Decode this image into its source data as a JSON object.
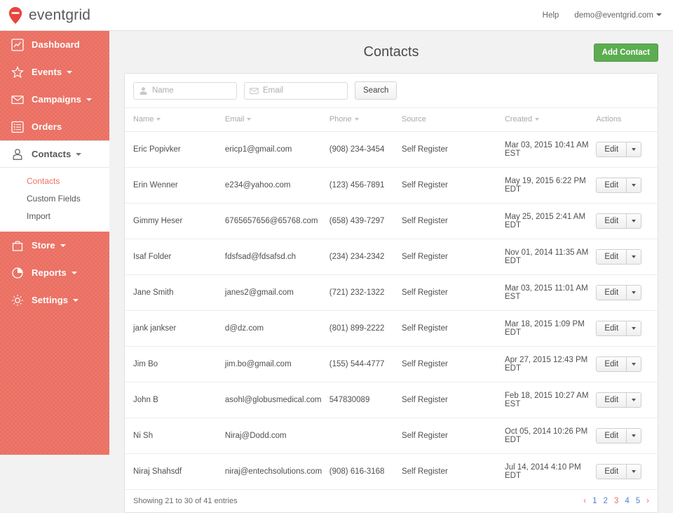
{
  "brand": {
    "name": "eventgrid",
    "logo_icon": "location-pin-icon",
    "accent": "#eb6f62"
  },
  "topbar": {
    "help_label": "Help",
    "account_label": "demo@eventgrid.com"
  },
  "sidebar": {
    "items": [
      {
        "label": "Dashboard",
        "icon": "chart-icon",
        "caret": false,
        "active": false
      },
      {
        "label": "Events",
        "icon": "star-icon",
        "caret": true,
        "active": false
      },
      {
        "label": "Campaigns",
        "icon": "envelope-icon",
        "caret": true,
        "active": false
      },
      {
        "label": "Orders",
        "icon": "list-icon",
        "caret": false,
        "active": false
      },
      {
        "label": "Contacts",
        "icon": "person-icon",
        "caret": true,
        "active": true
      },
      {
        "label": "Store",
        "icon": "bag-icon",
        "caret": true,
        "active": false
      },
      {
        "label": "Reports",
        "icon": "pie-icon",
        "caret": true,
        "active": false
      },
      {
        "label": "Settings",
        "icon": "gear-icon",
        "caret": true,
        "active": false
      }
    ],
    "submenu": [
      {
        "label": "Contacts",
        "current": true
      },
      {
        "label": "Custom Fields",
        "current": false
      },
      {
        "label": "Import",
        "current": false
      }
    ]
  },
  "page": {
    "title": "Contacts",
    "add_button_label": "Add Contact",
    "add_button_color": "#5cad51"
  },
  "search": {
    "name_placeholder": "Name",
    "name_value": "",
    "name_icon": "person-icon",
    "email_placeholder": "Email",
    "email_value": "",
    "email_icon": "envelope-icon",
    "search_button_label": "Search"
  },
  "table": {
    "columns": [
      {
        "label": "Name",
        "sortable": true
      },
      {
        "label": "Email",
        "sortable": true
      },
      {
        "label": "Phone",
        "sortable": true
      },
      {
        "label": "Source",
        "sortable": false
      },
      {
        "label": "Created",
        "sortable": true
      },
      {
        "label": "Actions",
        "sortable": false
      }
    ],
    "edit_label": "Edit",
    "rows": [
      {
        "name": "Eric Popivker",
        "email": "ericp1@gmail.com",
        "phone": "(908) 234-3454",
        "source": "Self Register",
        "created": "Mar 03, 2015 10:41 AM EST"
      },
      {
        "name": "Erin Wenner",
        "email": "e234@yahoo.com",
        "phone": "(123) 456-7891",
        "source": "Self Register",
        "created": "May 19, 2015 6:22 PM EDT"
      },
      {
        "name": "Gimmy Heser",
        "email": "6765657656@65768.com",
        "phone": "(658) 439-7297",
        "source": "Self Register",
        "created": "May 25, 2015 2:41 AM EDT"
      },
      {
        "name": "Isaf Folder",
        "email": "fdsfsad@fdsafsd.ch",
        "phone": "(234) 234-2342",
        "source": "Self Register",
        "created": "Nov 01, 2014 11:35 AM EDT"
      },
      {
        "name": "Jane Smith",
        "email": "janes2@gmail.com",
        "phone": "(721) 232-1322",
        "source": "Self Register",
        "created": "Mar 03, 2015 11:01 AM EST"
      },
      {
        "name": "jank jankser",
        "email": "d@dz.com",
        "phone": "(801) 899-2222",
        "source": "Self Register",
        "created": "Mar 18, 2015 1:09 PM EDT"
      },
      {
        "name": "Jim Bo",
        "email": "jim.bo@gmail.com",
        "phone": "(155) 544-4777",
        "source": "Self Register",
        "created": "Apr 27, 2015 12:43 PM EDT"
      },
      {
        "name": "John B",
        "email": "asohl@globusmedical.com",
        "phone": "547830089",
        "source": "Self Register",
        "created": "Feb 18, 2015 10:27 AM EST"
      },
      {
        "name": "Ni Sh",
        "email": "Niraj@Dodd.com",
        "phone": "",
        "source": "Self Register",
        "created": "Oct 05, 2014 10:26 PM EDT"
      },
      {
        "name": "Niraj Shahsdf",
        "email": "niraj@entechsolutions.com",
        "phone": "(908) 616-3168",
        "source": "Self Register",
        "created": "Jul 14, 2014 4:10 PM EDT"
      }
    ]
  },
  "footer": {
    "summary": "Showing 21 to 30 of 41 entries",
    "prev_label": "‹",
    "next_label": "›",
    "pages": [
      {
        "label": "1",
        "current": false
      },
      {
        "label": "2",
        "current": false
      },
      {
        "label": "3",
        "current": true
      },
      {
        "label": "4",
        "current": false
      },
      {
        "label": "5",
        "current": false
      }
    ]
  }
}
